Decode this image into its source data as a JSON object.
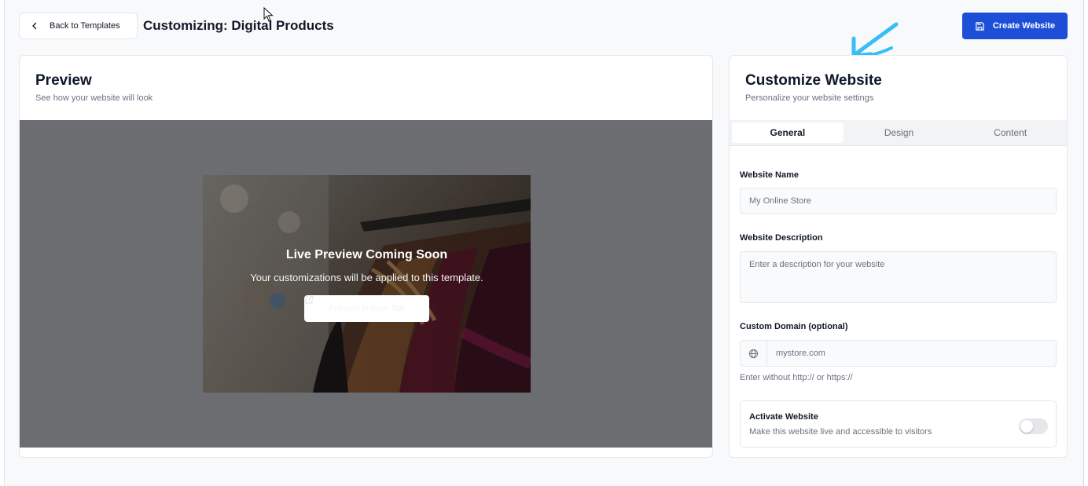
{
  "header": {
    "back_label": "Back to Templates",
    "page_title": "Customizing: Digital Products",
    "create_label": "Create Website"
  },
  "preview": {
    "title": "Preview",
    "subtitle": "See how your website will look",
    "overlay_title": "Live Preview Coming Soon",
    "overlay_subtitle": "Your customizations will be applied to this template.",
    "button_label": "Preview in New Tab"
  },
  "customize": {
    "title": "Customize Website",
    "subtitle": "Personalize your website settings",
    "tabs": [
      {
        "label": "General",
        "active": true
      },
      {
        "label": "Design",
        "active": false
      },
      {
        "label": "Content",
        "active": false
      }
    ],
    "fields": {
      "name_label": "Website Name",
      "name_placeholder": "My Online Store",
      "desc_label": "Website Description",
      "desc_placeholder": "Enter a description for your website",
      "domain_label": "Custom Domain (optional)",
      "domain_placeholder": "mystore.com",
      "domain_hint": "Enter without http:// or https://"
    },
    "activate": {
      "title": "Activate Website",
      "subtitle": "Make this website live and accessible to visitors",
      "enabled": false
    }
  },
  "colors": {
    "accent": "#1d4ed8",
    "annotation": "#38bdf8"
  },
  "icons": {
    "back": "chevron-left-icon",
    "create": "save-icon",
    "domain": "globe-icon",
    "preview": "external-link-icon"
  }
}
